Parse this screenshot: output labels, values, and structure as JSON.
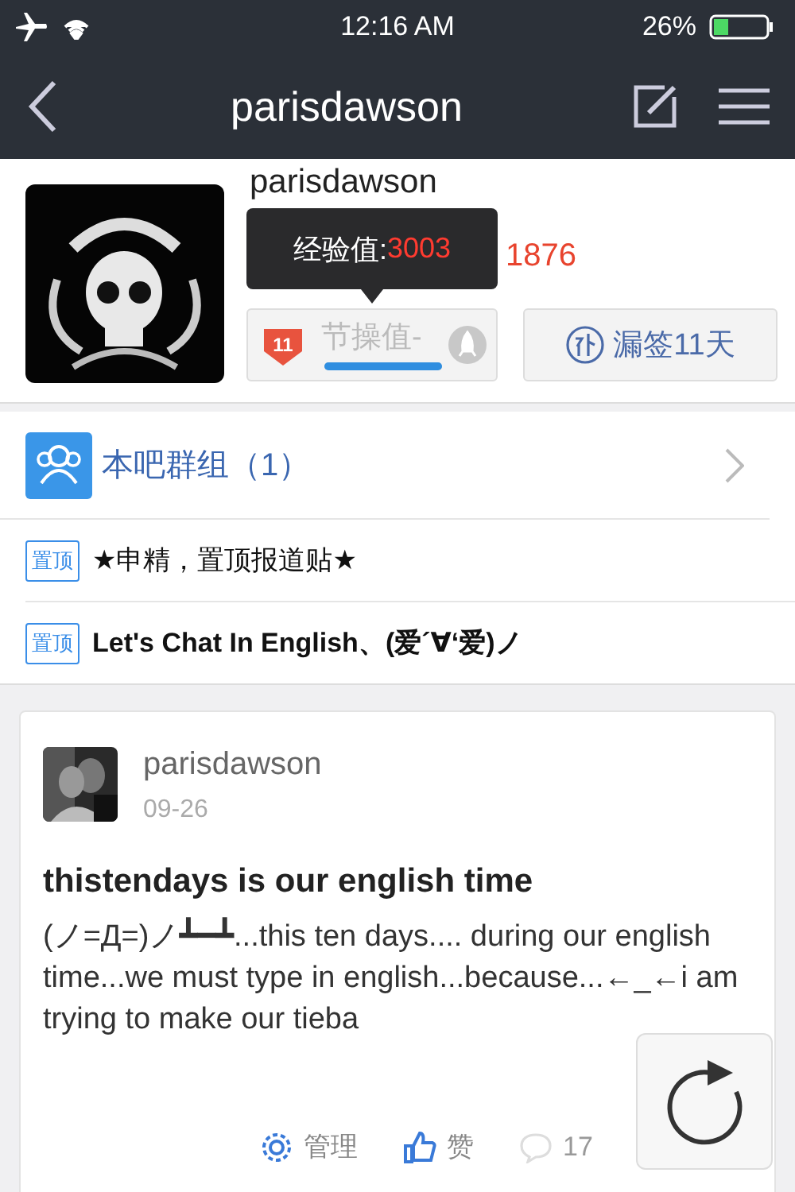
{
  "status_bar": {
    "time": "12:16 AM",
    "battery": "26%"
  },
  "nav": {
    "title": "parisdawson"
  },
  "profile": {
    "name": "parisdawson",
    "stats_visible": "1876",
    "tooltip": {
      "label": "经验值: ",
      "value": "3003"
    },
    "rank_badge": "11",
    "integrity": {
      "label": "节操值-",
      "level": 1
    },
    "sign_button": "漏签11天"
  },
  "group_row": {
    "label": "本吧群组（1）"
  },
  "pinned": [
    {
      "tag": "置顶",
      "title": "★申精，置顶报道贴★",
      "bold": false
    },
    {
      "tag": "置顶",
      "title": "Let's Chat In English、(爱´∀‘爱)ノ",
      "bold": true
    }
  ],
  "post": {
    "author": "parisdawson",
    "date": "09-26",
    "title": "thistendays is our english time",
    "body": "(ノ=Д=)ノ┻━┻...this ten days.... during our english time...we must type in english...because...←_←i am trying to make our tieba",
    "actions": [
      {
        "kind": "manage",
        "label": "管理"
      },
      {
        "kind": "like",
        "label": "赞"
      },
      {
        "kind": "comment",
        "label": "17"
      }
    ]
  }
}
